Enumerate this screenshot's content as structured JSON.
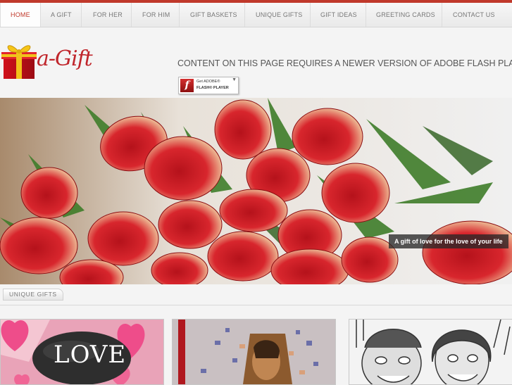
{
  "nav": {
    "items": [
      "HOME",
      "A GIFT",
      "FOR HER",
      "FOR HIM",
      "GIFT BASKETS",
      "UNIQUE GIFTS",
      "GIFT IDEAS",
      "GREETING CARDS",
      "CONTACT US"
    ],
    "active_index": 0,
    "accent_color": "#c0392b"
  },
  "logo": {
    "text": "a-Gift",
    "icon": "gift-box-icon"
  },
  "flash": {
    "message": "CONTENT ON THIS PAGE REQUIRES A NEWER VERSION OF ADOBE FLASH PLAYER.",
    "button_line1": "Get ADOBE®",
    "button_line2": "FLASH® PLAYER"
  },
  "hero": {
    "caption": "A gift of love for the love of your life"
  },
  "section": {
    "title": "UNIQUE GIFTS"
  },
  "thumbnails": [
    {
      "name": "love-stone-thumb",
      "text": "LOVE"
    },
    {
      "name": "puzzle-portrait-thumb"
    },
    {
      "name": "caricature-thumb"
    }
  ]
}
